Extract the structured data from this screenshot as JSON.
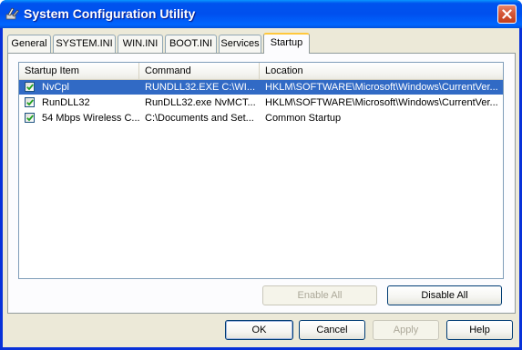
{
  "window": {
    "title": "System Configuration Utility",
    "icon": "config-utility-icon",
    "close_icon": "close-icon"
  },
  "tabs": [
    {
      "label": "General",
      "active": false
    },
    {
      "label": "SYSTEM.INI",
      "active": false
    },
    {
      "label": "WIN.INI",
      "active": false
    },
    {
      "label": "BOOT.INI",
      "active": false
    },
    {
      "label": "Services",
      "active": false
    },
    {
      "label": "Startup",
      "active": true
    }
  ],
  "startup_list": {
    "columns": [
      "Startup Item",
      "Command",
      "Location"
    ],
    "rows": [
      {
        "item": "NvCpl",
        "command": "RUNDLL32.EXE C:\\WI...",
        "location": "HKLM\\SOFTWARE\\Microsoft\\Windows\\CurrentVer...",
        "checked": true,
        "selected": true
      },
      {
        "item": "RunDLL32",
        "command": "RunDLL32.exe NvMCT...",
        "location": "HKLM\\SOFTWARE\\Microsoft\\Windows\\CurrentVer...",
        "checked": true,
        "selected": false
      },
      {
        "item": "54 Mbps Wireless C...",
        "command": "C:\\Documents and Set...",
        "location": "Common Startup",
        "checked": true,
        "selected": false
      }
    ]
  },
  "panel_buttons": {
    "enable_all": "Enable All",
    "disable_all": "Disable All"
  },
  "dialog_buttons": {
    "ok": "OK",
    "cancel": "Cancel",
    "apply": "Apply",
    "help": "Help"
  },
  "colors": {
    "selection": "#316ac5",
    "titlebar": "#0053ee",
    "dialog_face": "#ece9d8"
  }
}
